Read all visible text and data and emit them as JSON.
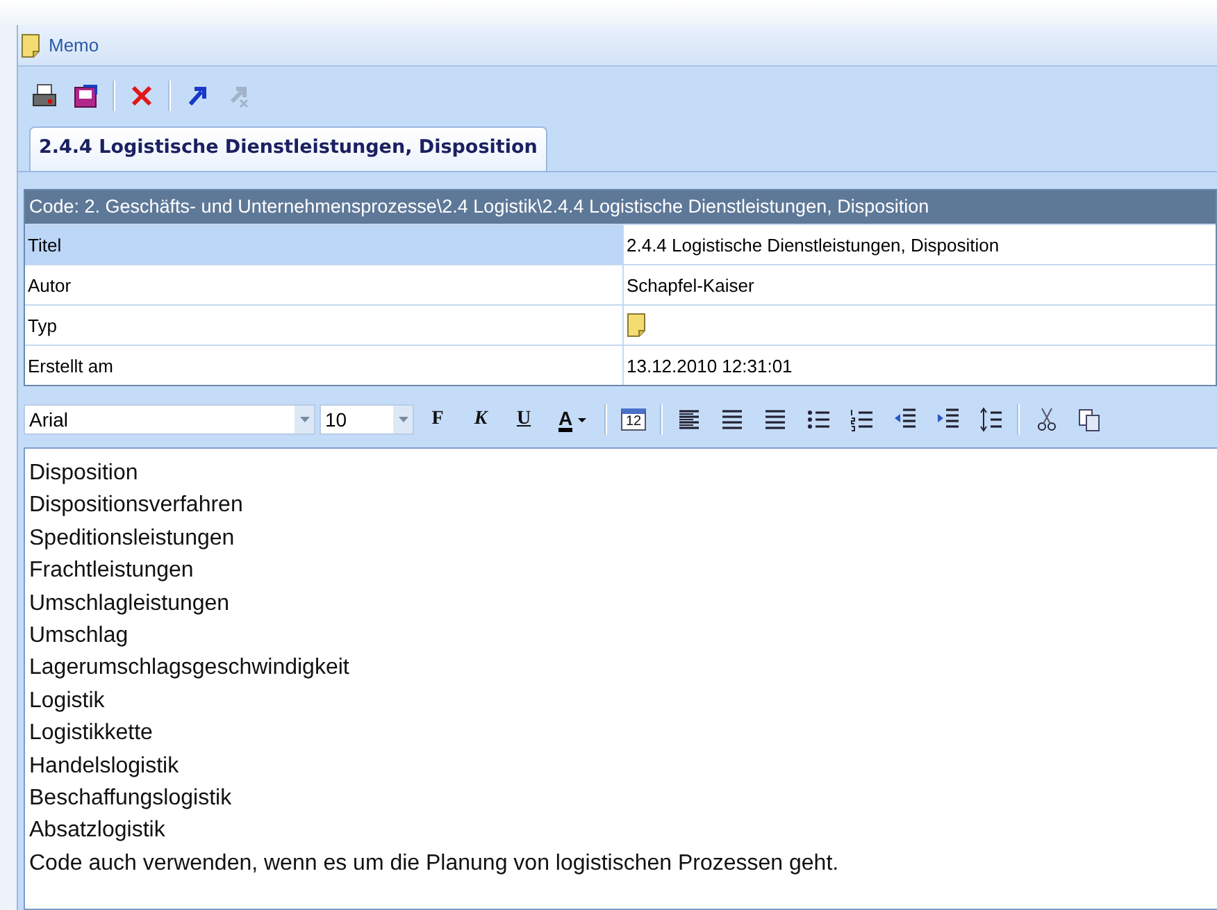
{
  "window": {
    "title": "Memo"
  },
  "toolbar": [
    {
      "kind": "print",
      "disabled": false
    },
    {
      "kind": "export",
      "disabled": false
    },
    {
      "kind": "separator"
    },
    {
      "kind": "delete",
      "disabled": false
    },
    {
      "kind": "separator"
    },
    {
      "kind": "link",
      "disabled": false
    },
    {
      "kind": "unlink",
      "disabled": true
    }
  ],
  "tabs": [
    {
      "label": "2.4.4 Logistische Dienstleistungen, Disposition",
      "selected": true
    }
  ],
  "properties": {
    "header": "Code: 2. Geschäfts- und Unternehmensprozesse\\2.4 Logistik\\2.4.4 Logistische Dienstleistungen, Disposition",
    "rows": [
      {
        "label": "Titel",
        "value": "2.4.4 Logistische Dienstleistungen, Disposition",
        "kind": "text",
        "selected": true
      },
      {
        "label": "Autor",
        "value": "Schapfel-Kaiser",
        "kind": "text",
        "selected": false
      },
      {
        "label": "Typ",
        "kind": "memo-icon",
        "selected": false
      },
      {
        "label": "Erstellt am",
        "value": "13.12.2010 12:31:01",
        "kind": "text",
        "selected": false
      }
    ]
  },
  "format_toolbar": {
    "font": "Arial",
    "size": "10",
    "bold": "F",
    "italic": "K",
    "underline": "U",
    "font_color": "A",
    "date_day": "12"
  },
  "editor": {
    "lines": [
      "Disposition",
      "Dispositionsverfahren",
      "Speditionsleistungen",
      "Frachtleistungen",
      "Umschlagleistungen",
      "Umschlag",
      "Lagerumschlagsgeschwindigkeit",
      "Logistik",
      "Logistikkette",
      "Handelslogistik",
      "Beschaffungslogistik",
      "Absatzlogistik",
      "Code auch verwenden, wenn es um die Planung von logistischen Prozessen geht."
    ]
  }
}
